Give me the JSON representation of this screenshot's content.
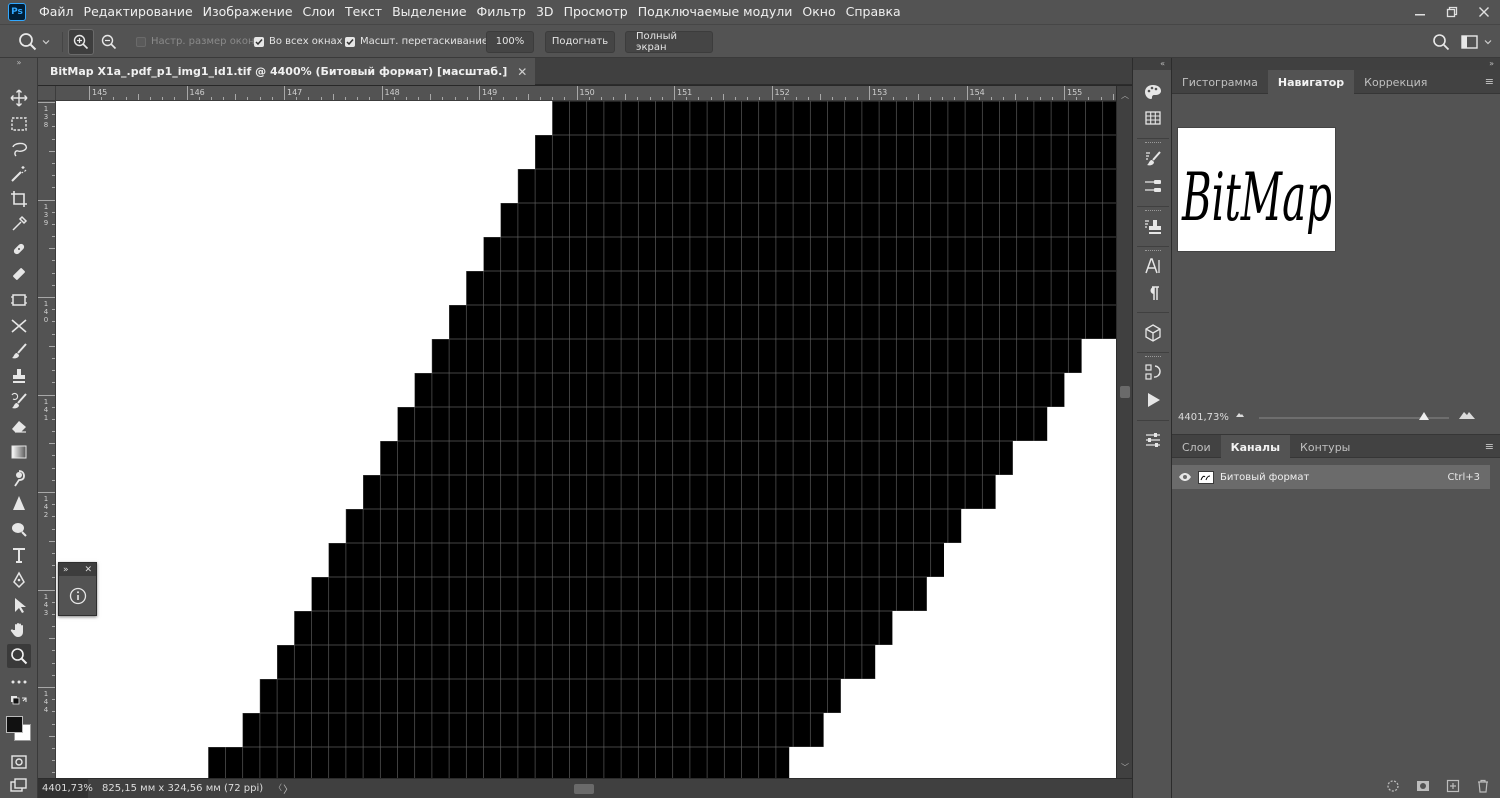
{
  "app": {
    "logo_text": "Ps",
    "menu": [
      "Файл",
      "Редактирование",
      "Изображение",
      "Слои",
      "Текст",
      "Выделение",
      "Фильтр",
      "3D",
      "Просмотр",
      "Подключаемые модули",
      "Окно",
      "Справка"
    ]
  },
  "options_bar": {
    "resize_windows_label": "Настр. размер окон",
    "all_windows_label": "Во всех окнах",
    "scrubby_zoom_label": "Масшт. перетаскиванием",
    "zoom_value": "100%",
    "fit_label": "Подогнать",
    "fullscreen_label": "Полный экран"
  },
  "document": {
    "tab_title": "BitMap X1a_.pdf_p1_img1_id1.tif @ 4400% (Битовый формат) [масштаб.]",
    "ruler_h_labels": [
      "145",
      "146",
      "147",
      "148",
      "149",
      "150",
      "151",
      "152",
      "153",
      "154",
      "155"
    ],
    "ruler_v_labels": [
      "138",
      "139",
      "140",
      "141",
      "142",
      "143",
      "144"
    ]
  },
  "status": {
    "zoom": "4401,73%",
    "info": "825,15 мм x 324,56 мм (72 ppi)",
    "arrow": "〉"
  },
  "panels": {
    "top_tabs": [
      "Гистограмма",
      "Навигатор",
      "Коррекция"
    ],
    "top_active": "Навигатор",
    "navigator_thumbnail_text": "BitMap",
    "navigator_zoom": "4401,73%",
    "navigator_zoom_level": 0.87,
    "bottom_tabs": [
      "Слои",
      "Каналы",
      "Контуры"
    ],
    "bottom_active": "Каналы",
    "channel": {
      "name": "Битовый формат",
      "shortcut": "Ctrl+3"
    }
  },
  "colors": {
    "menubar_bg": "#535353",
    "canvas_fill": "#000000",
    "canvas_bg": "#ffffff",
    "accent": "#31a8ff"
  }
}
